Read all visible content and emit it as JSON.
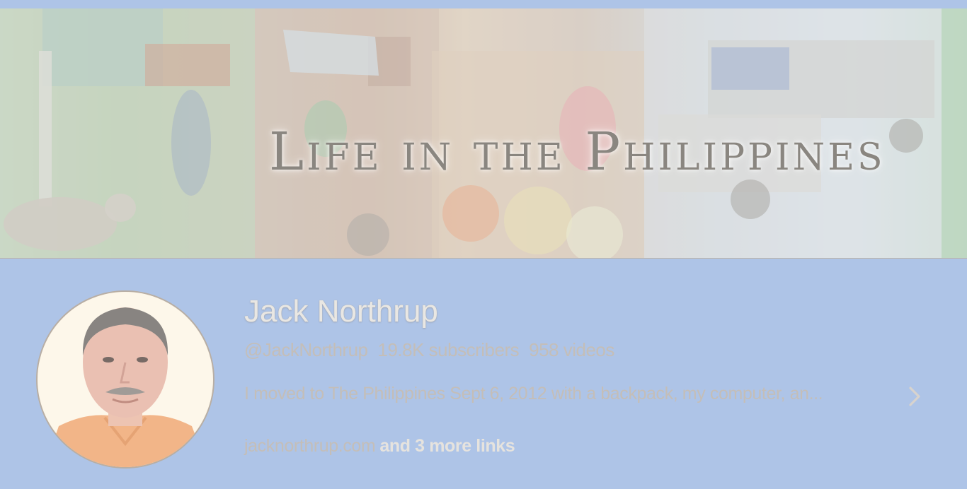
{
  "banner": {
    "title": "Life in the Philippines"
  },
  "channel": {
    "name": "Jack Northrup",
    "handle": "@JackNorthrup",
    "subscribers": "19.8K subscribers",
    "videos": "958 videos",
    "description": "I moved to The Philippines Sept 6, 2012 with a backpack, my computer, an...",
    "link_main": "jacknorthrup.com",
    "link_more": "and 3 more links"
  },
  "icons": {
    "description_expand": "chevron-right-icon"
  },
  "colors": {
    "background": "#aec4e7",
    "name_text": "#e9e7e3",
    "meta_text": "#c4beb8",
    "avatar_bg": "#fdf6e6",
    "shirt": "#f0a56e"
  }
}
